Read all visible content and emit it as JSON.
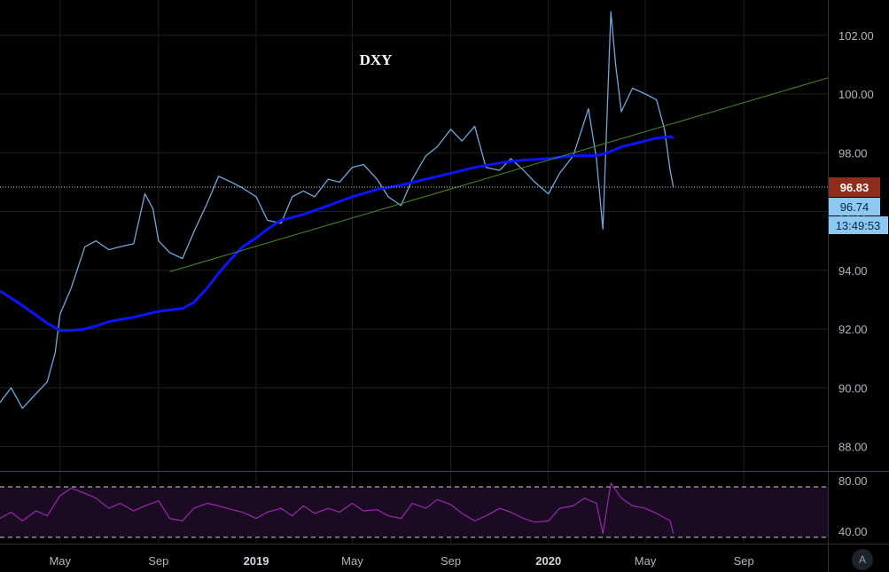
{
  "colors": {
    "background": "#000000",
    "grid": "#1c1f26",
    "price_line": "#6fa8dc",
    "moving_average": "#0a14ff",
    "trend_line": "#4c8a2a",
    "rsi_line": "#9c27b0",
    "rsi_band_fill": "#1a0a22",
    "last_price_tag": "#8f2d1d",
    "current_price_tag": "#8cc8f2",
    "axis_text": "#b2b5be"
  },
  "chart_data": {
    "type": "line",
    "title": "DXY",
    "price_axis": {
      "ylim": [
        87.2,
        103.2
      ],
      "ticks": [
        88,
        90,
        92,
        94,
        96,
        98,
        100,
        102
      ],
      "tick_labels": [
        "88.00",
        "90.00",
        "92.00",
        "94.00",
        "96.00",
        "98.00",
        "100.00",
        "102.00"
      ]
    },
    "time_axis": {
      "xlim": [
        "2018-02-15",
        "2020-12-15"
      ],
      "tick_labels": [
        {
          "label": "May",
          "date": "2018-05-01",
          "year": false
        },
        {
          "label": "Sep",
          "date": "2018-09-01",
          "year": false
        },
        {
          "label": "2019",
          "date": "2019-01-01",
          "year": true
        },
        {
          "label": "May",
          "date": "2019-05-01",
          "year": false
        },
        {
          "label": "Sep",
          "date": "2019-09-01",
          "year": false
        },
        {
          "label": "2020",
          "date": "2020-01-01",
          "year": true
        },
        {
          "label": "May",
          "date": "2020-05-01",
          "year": false
        },
        {
          "label": "Sep",
          "date": "2020-09-01",
          "year": false
        }
      ]
    },
    "grid": true,
    "series": [
      {
        "key": "price",
        "style": "thin",
        "x": [
          "2018-02-15",
          "2018-03-01",
          "2018-03-15",
          "2018-04-01",
          "2018-04-15",
          "2018-04-25",
          "2018-05-01",
          "2018-05-15",
          "2018-06-01",
          "2018-06-15",
          "2018-07-01",
          "2018-07-15",
          "2018-08-01",
          "2018-08-15",
          "2018-08-25",
          "2018-09-01",
          "2018-09-15",
          "2018-10-01",
          "2018-10-15",
          "2018-11-01",
          "2018-11-15",
          "2018-12-01",
          "2018-12-15",
          "2019-01-01",
          "2019-01-15",
          "2019-02-01",
          "2019-02-15",
          "2019-03-01",
          "2019-03-15",
          "2019-04-01",
          "2019-04-15",
          "2019-05-01",
          "2019-05-15",
          "2019-06-01",
          "2019-06-15",
          "2019-07-01",
          "2019-07-15",
          "2019-08-01",
          "2019-08-15",
          "2019-09-01",
          "2019-09-15",
          "2019-10-01",
          "2019-10-15",
          "2019-11-01",
          "2019-11-15",
          "2019-12-01",
          "2019-12-15",
          "2020-01-01",
          "2020-01-15",
          "2020-02-01",
          "2020-02-20",
          "2020-03-01",
          "2020-03-09",
          "2020-03-19",
          "2020-03-25",
          "2020-04-01",
          "2020-04-15",
          "2020-05-01",
          "2020-05-15",
          "2020-05-25",
          "2020-06-01",
          "2020-06-05"
        ],
        "values": [
          89.5,
          90.0,
          89.3,
          89.8,
          90.2,
          91.2,
          92.5,
          93.4,
          94.8,
          95.0,
          94.7,
          94.8,
          94.9,
          96.6,
          96.1,
          95.0,
          94.6,
          94.4,
          95.3,
          96.3,
          97.2,
          97.0,
          96.8,
          96.5,
          95.7,
          95.6,
          96.5,
          96.7,
          96.5,
          97.1,
          97.0,
          97.5,
          97.6,
          97.1,
          96.5,
          96.2,
          97.1,
          97.9,
          98.2,
          98.8,
          98.4,
          98.9,
          97.5,
          97.4,
          97.8,
          97.4,
          97.0,
          96.6,
          97.3,
          97.9,
          99.5,
          97.8,
          95.4,
          102.8,
          101.0,
          99.4,
          100.2,
          100.0,
          99.8,
          98.8,
          97.4,
          96.83
        ]
      },
      {
        "key": "moving_average",
        "style": "thick",
        "x": [
          "2018-02-15",
          "2018-03-15",
          "2018-04-15",
          "2018-05-01",
          "2018-05-15",
          "2018-06-01",
          "2018-06-15",
          "2018-07-01",
          "2018-08-01",
          "2018-09-01",
          "2018-10-01",
          "2018-10-15",
          "2018-11-01",
          "2018-11-15",
          "2018-12-01",
          "2018-12-15",
          "2019-01-01",
          "2019-01-15",
          "2019-02-01",
          "2019-03-01",
          "2019-04-01",
          "2019-05-01",
          "2019-06-01",
          "2019-07-01",
          "2019-08-01",
          "2019-09-01",
          "2019-10-01",
          "2019-11-01",
          "2019-12-01",
          "2020-01-01",
          "2020-02-01",
          "2020-03-01",
          "2020-03-15",
          "2020-04-01",
          "2020-05-01",
          "2020-05-15",
          "2020-06-01",
          "2020-06-05"
        ],
        "values": [
          93.3,
          92.8,
          92.2,
          91.95,
          91.95,
          92.0,
          92.1,
          92.25,
          92.4,
          92.6,
          92.7,
          92.9,
          93.4,
          93.9,
          94.4,
          94.8,
          95.1,
          95.4,
          95.7,
          95.9,
          96.2,
          96.5,
          96.75,
          96.9,
          97.1,
          97.3,
          97.5,
          97.65,
          97.75,
          97.8,
          97.9,
          97.9,
          98.0,
          98.2,
          98.4,
          98.5,
          98.55,
          98.5
        ]
      },
      {
        "key": "trend_line",
        "style": "hairline",
        "x": [
          "2018-09-15",
          "2020-12-15"
        ],
        "values": [
          93.95,
          100.55
        ]
      }
    ],
    "last_price": {
      "value": "96.83",
      "level": 96.83
    },
    "current_price": {
      "value": "96.74",
      "time": "13:49:53"
    },
    "rsi": {
      "ylim": [
        30,
        87
      ],
      "tick_labels": [
        "80.00",
        "40.00"
      ],
      "ticks": [
        80,
        40
      ],
      "band_upper": 75,
      "band_lower": 35,
      "x": [
        "2018-02-15",
        "2018-03-01",
        "2018-03-15",
        "2018-04-01",
        "2018-04-15",
        "2018-05-01",
        "2018-05-15",
        "2018-06-01",
        "2018-06-15",
        "2018-07-01",
        "2018-07-15",
        "2018-08-01",
        "2018-08-15",
        "2018-09-01",
        "2018-09-15",
        "2018-10-01",
        "2018-10-15",
        "2018-11-01",
        "2018-11-15",
        "2018-12-01",
        "2018-12-15",
        "2019-01-01",
        "2019-01-15",
        "2019-02-01",
        "2019-02-15",
        "2019-03-01",
        "2019-03-15",
        "2019-04-01",
        "2019-04-15",
        "2019-05-01",
        "2019-05-15",
        "2019-06-01",
        "2019-06-15",
        "2019-07-01",
        "2019-07-15",
        "2019-08-01",
        "2019-08-15",
        "2019-09-01",
        "2019-09-15",
        "2019-10-01",
        "2019-10-15",
        "2019-11-01",
        "2019-11-15",
        "2019-12-01",
        "2019-12-15",
        "2020-01-01",
        "2020-01-15",
        "2020-02-01",
        "2020-02-15",
        "2020-03-01",
        "2020-03-09",
        "2020-03-19",
        "2020-04-01",
        "2020-04-15",
        "2020-05-01",
        "2020-05-15",
        "2020-06-01",
        "2020-06-05"
      ],
      "values": [
        50,
        55,
        48,
        56,
        52,
        68,
        74,
        70,
        66,
        58,
        62,
        56,
        60,
        64,
        50,
        48,
        58,
        62,
        60,
        57,
        55,
        50,
        55,
        58,
        52,
        60,
        54,
        58,
        55,
        62,
        56,
        57,
        52,
        50,
        62,
        58,
        65,
        61,
        54,
        48,
        52,
        58,
        55,
        50,
        47,
        48,
        58,
        60,
        66,
        62,
        38,
        78,
        66,
        60,
        58,
        54,
        48,
        38
      ]
    }
  }
}
